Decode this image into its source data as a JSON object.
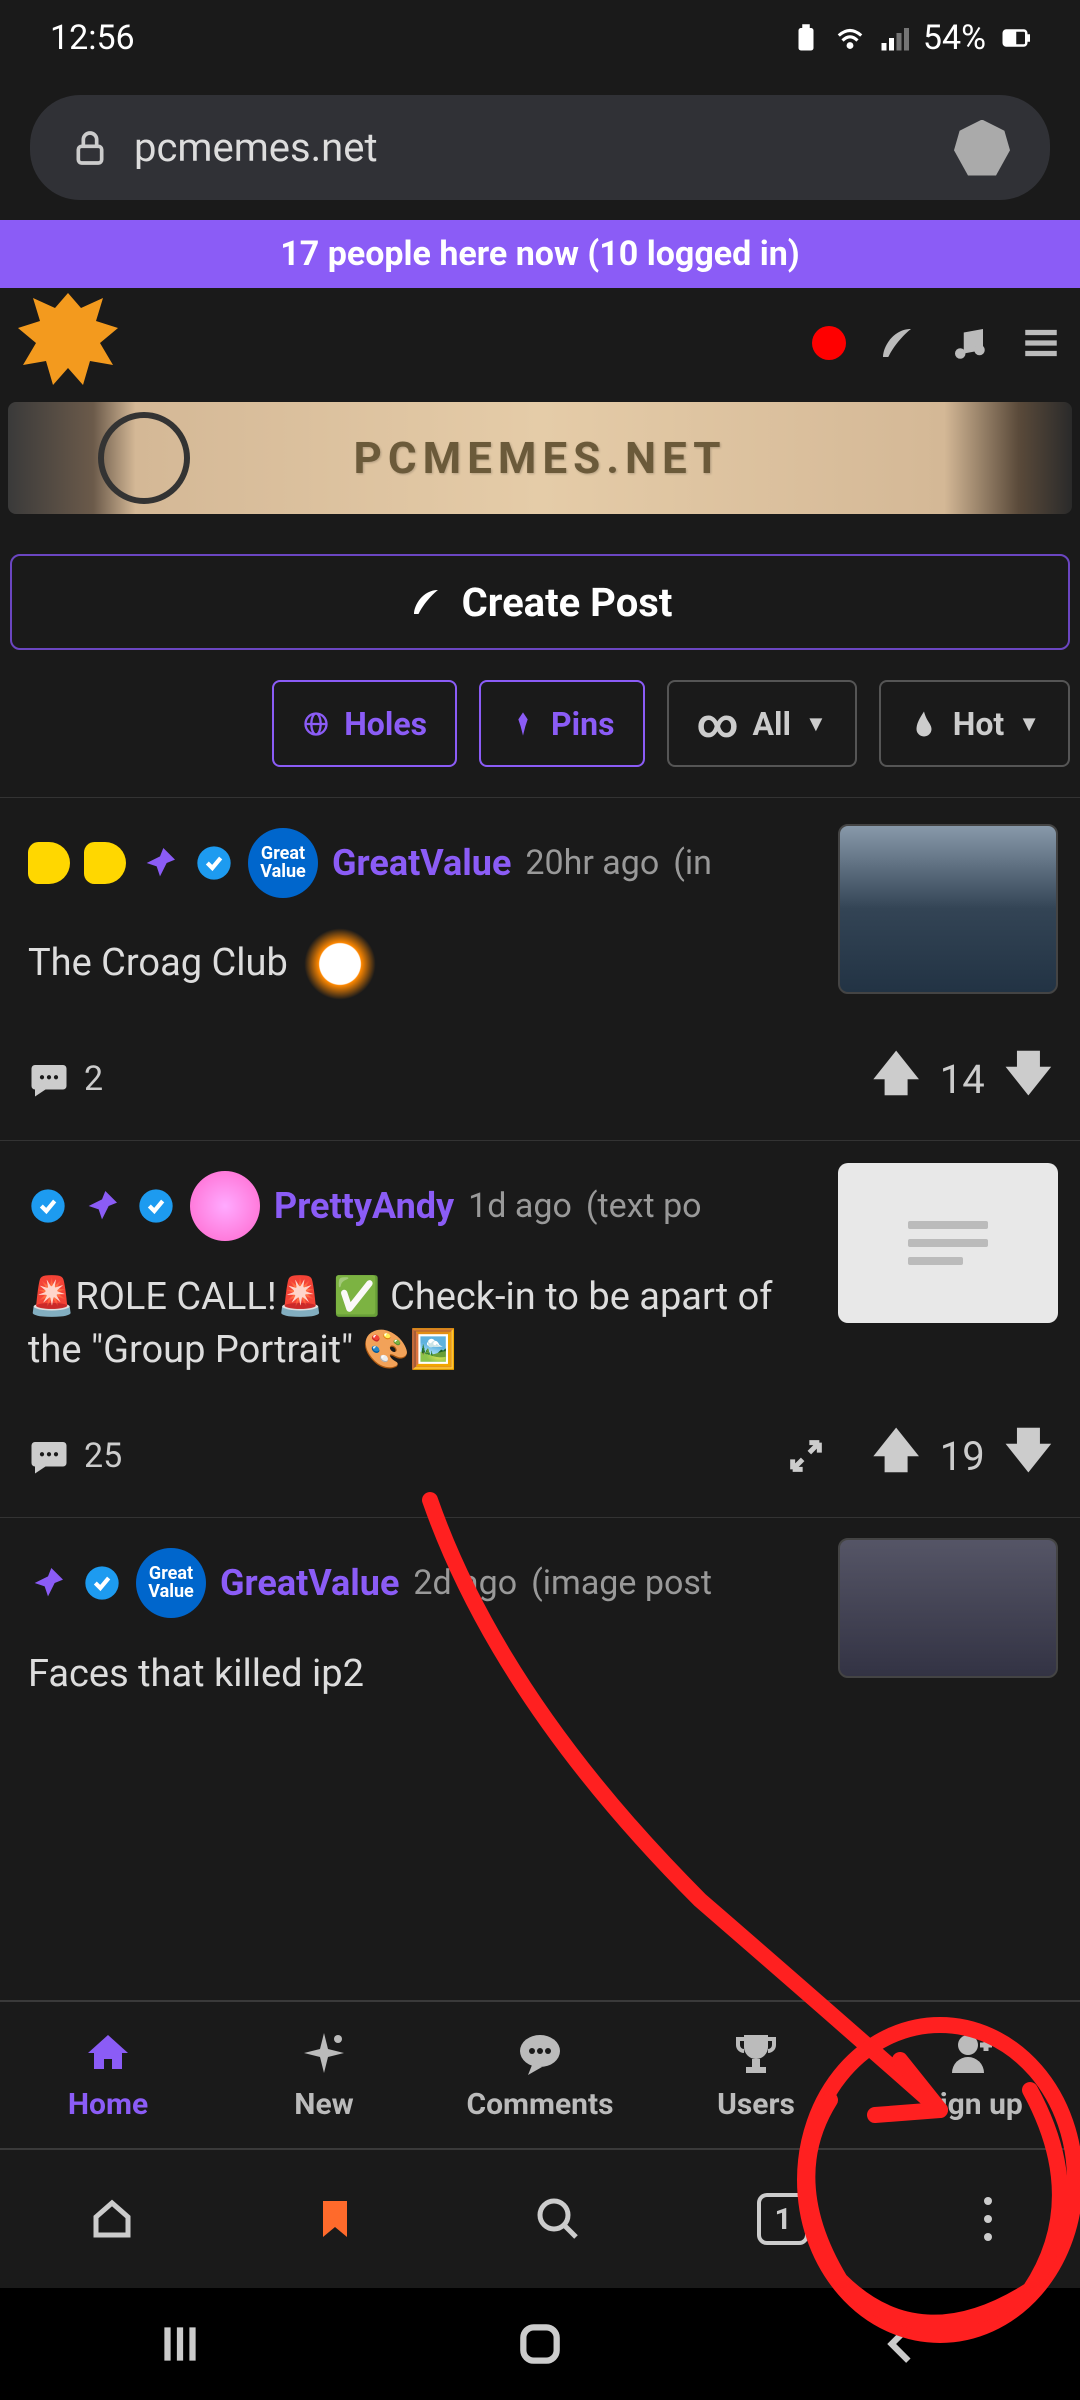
{
  "status": {
    "time": "12:56",
    "battery": "54%"
  },
  "browser": {
    "url": "pcmemes.net",
    "tab_count": "1"
  },
  "announce": "17 people here now (10 logged in)",
  "banner_text": "PCMEMES.NET",
  "create_post": "Create Post",
  "filters": {
    "holes": "Holes",
    "pins": "Pins",
    "all": "All",
    "hot": "Hot"
  },
  "posts": [
    {
      "author": "GreatValue",
      "avatar_label": "Great\nValue",
      "time": "20hr ago",
      "category": "(in",
      "title": "The Croag Club",
      "comments": "2",
      "score": "14"
    },
    {
      "author": "PrettyAndy",
      "time": "1d ago",
      "category": "(text po",
      "title": "🚨ROLE CALL!🚨 ✅ Check-in to be apart of the \"Group Portrait\" 🎨🖼️",
      "comments": "25",
      "score": "19"
    },
    {
      "author": "GreatValue",
      "avatar_label": "Great\nValue",
      "time": "2d ago",
      "category": "(image post",
      "title": "Faces that killed ip2",
      "comments": "",
      "score": ""
    }
  ],
  "tabs": {
    "home": "Home",
    "new": "New",
    "comments": "Comments",
    "users": "Users",
    "signup": "Sign up"
  }
}
